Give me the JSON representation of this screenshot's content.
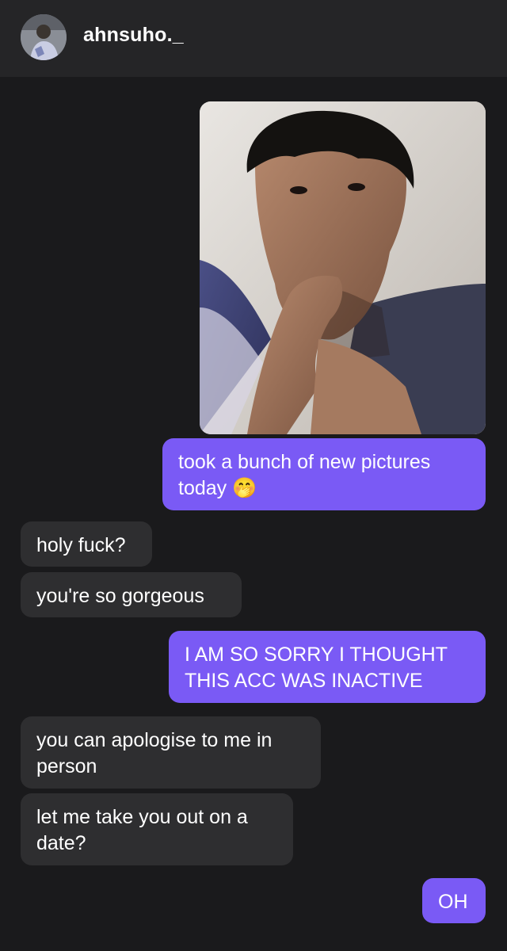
{
  "header": {
    "username": "ahnsuho._",
    "avatar_icon": "profile-avatar"
  },
  "colors": {
    "background": "#1a1a1c",
    "header_bg": "#252527",
    "outgoing_bubble": "#7a5af5",
    "incoming_bubble": "#2e2e30",
    "text": "#ffffff"
  },
  "messages": [
    {
      "from": "me",
      "type": "image",
      "content": "photo-of-person-lying-on-bed"
    },
    {
      "from": "me",
      "type": "text",
      "text": "took a bunch of new pictures today 🤭"
    },
    {
      "from": "them",
      "type": "text",
      "text": "holy fuck?"
    },
    {
      "from": "them",
      "type": "text",
      "text": "you're so gorgeous"
    },
    {
      "from": "me",
      "type": "text",
      "text": "I AM SO SORRY I THOUGHT THIS ACC WAS INACTIVE"
    },
    {
      "from": "them",
      "type": "text",
      "text": "you can apologise to me in person"
    },
    {
      "from": "them",
      "type": "text",
      "text": "let me take you out on a date?"
    },
    {
      "from": "me",
      "type": "text",
      "text": "OH"
    }
  ]
}
